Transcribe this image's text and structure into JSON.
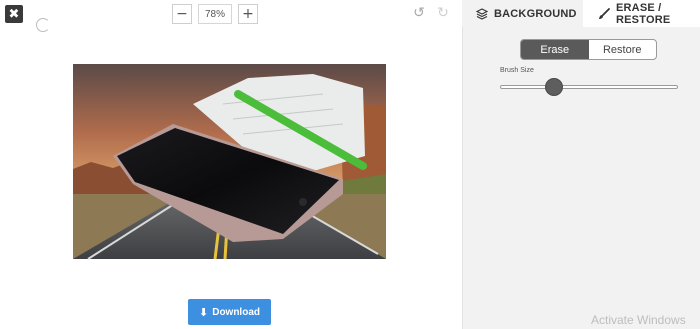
{
  "toolbar": {
    "close_symbol": "✖",
    "zoom_out_symbol": "−",
    "zoom_in_symbol": "+",
    "zoom_value": "78%",
    "undo_symbol": "↺",
    "redo_symbol": "↻"
  },
  "tabs": [
    {
      "label": "BACKGROUND",
      "icon": "layers-icon"
    },
    {
      "label": "ERASE / RESTORE",
      "icon": "brush-icon",
      "active": true
    }
  ],
  "mode": {
    "options": [
      "Erase",
      "Restore"
    ],
    "selected": "Erase"
  },
  "brush": {
    "label": "Brush Size",
    "value_fraction": 0.28
  },
  "download": {
    "label": "Download",
    "icon": "download-icon"
  },
  "watermark": "Activate Windows",
  "colors": {
    "accent": "#3d8fe0",
    "panel": "#f2f2f2",
    "active_segment": "#5a5a5a"
  }
}
